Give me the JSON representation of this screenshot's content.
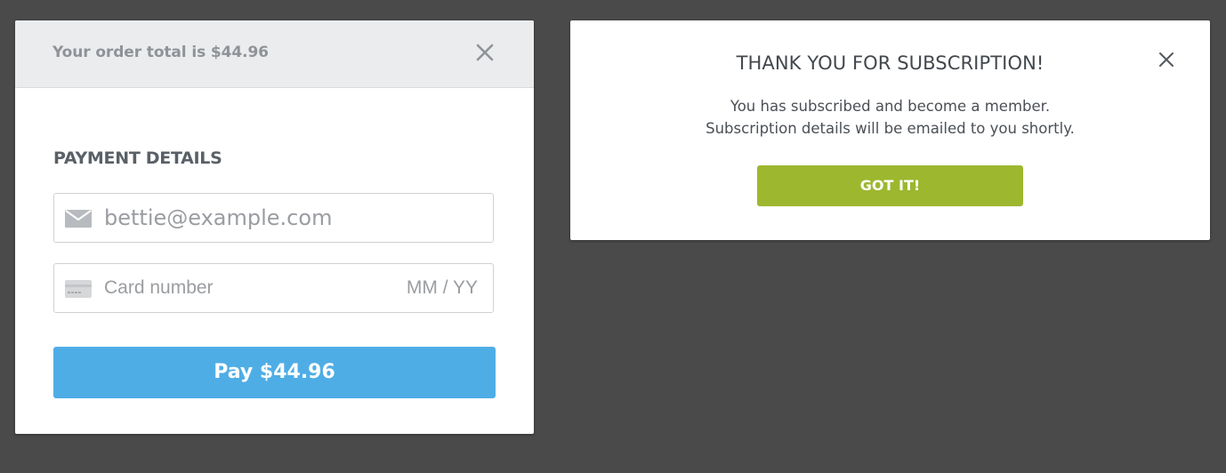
{
  "payment_modal": {
    "order_total_text": "Your order total is $44.96",
    "close_icon": "close-icon",
    "section_title": "PAYMENT DETAILS",
    "email": {
      "icon": "envelope-icon",
      "value": "bettie@example.com",
      "placeholder": "bettie@example.com"
    },
    "card": {
      "icon": "credit-card-icon",
      "number_placeholder": "Card number",
      "expiry_placeholder": "MM / YY"
    },
    "pay_button_label": "Pay $44.96",
    "accent_color": "#4fade6"
  },
  "subscription_modal": {
    "title": "THANK YOU FOR SUBSCRIPTION!",
    "close_icon": "close-icon",
    "message_line_1": "You has subscribed and become a member.",
    "message_line_2": "Subscription details will be emailed to you shortly.",
    "button_label": "GOT IT!",
    "button_color": "#9db72f"
  }
}
